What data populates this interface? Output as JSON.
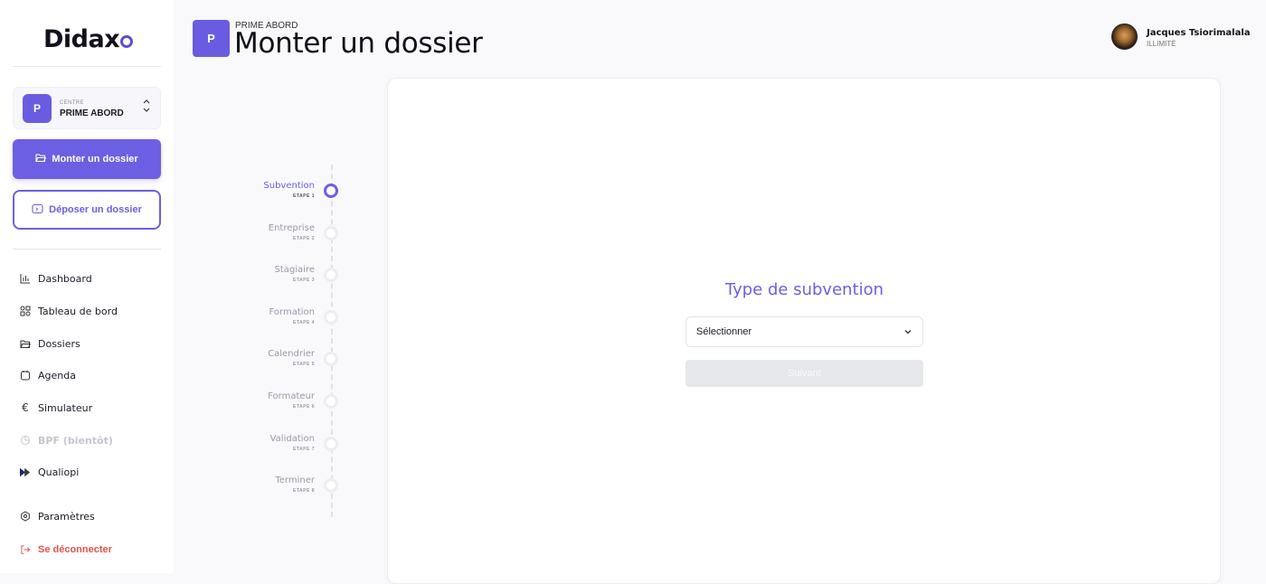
{
  "sidebar": {
    "logo_text": "Didax",
    "centre": {
      "avatar": "P",
      "caption": "CENTRE",
      "name": "PRIME ABORD"
    },
    "primary_button": {
      "label": "Monter un dossier",
      "icon": "folder-icon"
    },
    "outline_button": {
      "label": "Déposer un dossier",
      "icon": "folder-upload-icon"
    },
    "nav": [
      {
        "label": "Dashboard",
        "icon": "bar-chart-icon"
      },
      {
        "label": "Tableau de bord",
        "icon": "grid-icon"
      },
      {
        "label": "Dossiers",
        "icon": "folder-icon"
      },
      {
        "label": "Agenda",
        "icon": "calendar-icon"
      },
      {
        "label": "Simulateur",
        "icon": "euro-icon"
      },
      {
        "label": "BPF (bientôt)",
        "icon": "pie-chart-icon"
      },
      {
        "label": "Qualiopi",
        "icon": "qualiopi-icon"
      }
    ],
    "settings": {
      "label": "Paramètres",
      "icon": "gear-icon"
    },
    "logout": {
      "label": "Se déconnecter",
      "icon": "logout-icon"
    }
  },
  "header": {
    "avatar": "P",
    "subtitle": "PRIME ABORD",
    "title": "Monter un dossier"
  },
  "user": {
    "name": "Jacques Tsiorimalala",
    "plan": "ILLIMITÉ"
  },
  "steps": [
    {
      "label": "Subvention",
      "sub": "ETAPE 1",
      "active": true
    },
    {
      "label": "Entreprise",
      "sub": "ETAPE 2",
      "active": false
    },
    {
      "label": "Stagiaire",
      "sub": "ETAPE 3",
      "active": false
    },
    {
      "label": "Formation",
      "sub": "ETAPE 4",
      "active": false
    },
    {
      "label": "Calendrier",
      "sub": "ETAPE 5",
      "active": false
    },
    {
      "label": "Formateur",
      "sub": "ETAPE 6",
      "active": false
    },
    {
      "label": "Validation",
      "sub": "ETAPE 7",
      "active": false
    },
    {
      "label": "Terminer",
      "sub": "ETAPE 8",
      "active": false
    }
  ],
  "form": {
    "title": "Type de subvention",
    "select_value": "Sélectionner",
    "next_label": "Suivant"
  },
  "colors": {
    "accent": "#6c5fe3",
    "danger": "#e5514c",
    "disabled": "#e6e7ea"
  }
}
